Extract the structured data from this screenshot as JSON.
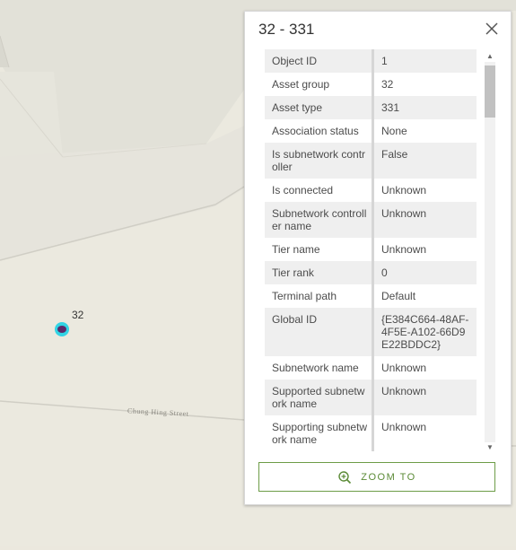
{
  "map": {
    "feature_label": "32",
    "street_label": "Chung Hing Street",
    "feature_color": "#32d4e4",
    "feature_inner_color": "#5b2a6a"
  },
  "popup": {
    "title": "32 - 331",
    "zoom_label": "ZOOM TO",
    "accent": "#5a8a35",
    "fields": [
      {
        "key": "Object ID",
        "value": "1"
      },
      {
        "key": "Asset group",
        "value": "32"
      },
      {
        "key": "Asset type",
        "value": "331"
      },
      {
        "key": "Association status",
        "value": "None"
      },
      {
        "key": "Is subnetwork controller",
        "value": "False"
      },
      {
        "key": "Is connected",
        "value": "Unknown"
      },
      {
        "key": "Subnetwork controller name",
        "value": "Unknown"
      },
      {
        "key": "Tier name",
        "value": "Unknown"
      },
      {
        "key": "Tier rank",
        "value": "0"
      },
      {
        "key": "Terminal path",
        "value": "Default"
      },
      {
        "key": "Global ID",
        "value": "{E384C664-48AF-4F5E-A102-66D9E22BDDC2}"
      },
      {
        "key": "Subnetwork name",
        "value": "Unknown"
      },
      {
        "key": "Supported subnetwork name",
        "value": "Unknown"
      },
      {
        "key": "Supporting subnetwork name",
        "value": "Unknown"
      }
    ]
  }
}
